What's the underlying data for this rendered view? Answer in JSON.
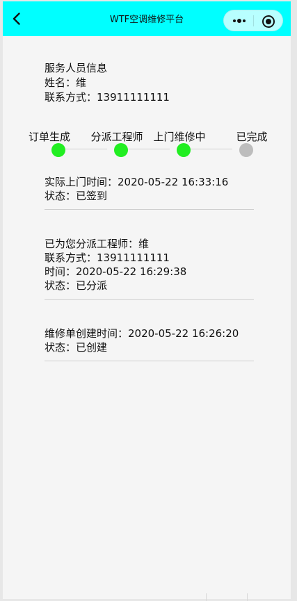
{
  "app": {
    "title": "WTF空调维修平台",
    "accent_color": "#00ffff"
  },
  "nav": {
    "back_icon": "chevron-left-icon",
    "more_icon": "more-dots-icon",
    "close_icon": "record-circle-icon"
  },
  "service_person": {
    "heading": "服务人员信息",
    "name_line": "姓名：维",
    "contact_line": "联系方式：13911111111"
  },
  "progress": {
    "active_color": "#22ee22",
    "inactive_color": "#bdbdbd",
    "steps": [
      {
        "label": "订单生成",
        "state": "done"
      },
      {
        "label": "分派工程师",
        "state": "done"
      },
      {
        "label": "上门维修中",
        "state": "done"
      },
      {
        "label": "已完成",
        "state": "pending"
      }
    ]
  },
  "records": [
    {
      "lines": [
        "实际上门时间：2020-05-22 16:33:16",
        "状态：已签到"
      ]
    },
    {
      "lines": [
        "已为您分派工程师：维",
        "联系方式：13911111111",
        "时间：2020-05-22 16:29:38",
        "状态：已分派"
      ]
    },
    {
      "lines": [
        "维修单创建时间：2020-05-22 16:26:20",
        "状态：已创建"
      ]
    }
  ]
}
